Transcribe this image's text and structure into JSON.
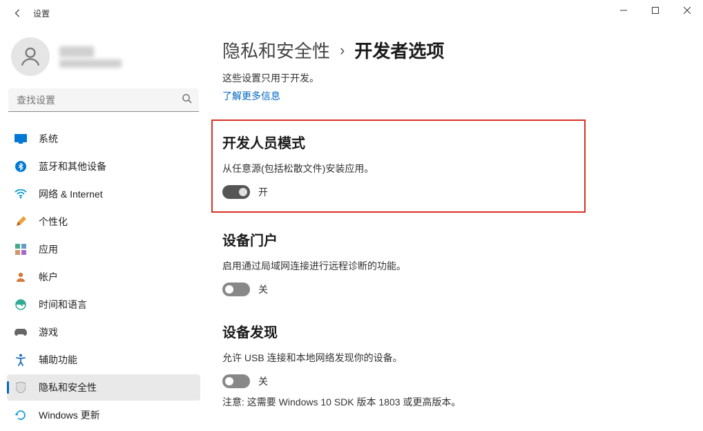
{
  "window": {
    "title": "设置"
  },
  "search": {
    "placeholder": "查找设置"
  },
  "sidebar": {
    "items": [
      {
        "label": "系统",
        "icon": "system"
      },
      {
        "label": "蓝牙和其他设备",
        "icon": "bluetooth"
      },
      {
        "label": "网络 & Internet",
        "icon": "network"
      },
      {
        "label": "个性化",
        "icon": "personalize"
      },
      {
        "label": "应用",
        "icon": "apps"
      },
      {
        "label": "帐户",
        "icon": "account"
      },
      {
        "label": "时间和语言",
        "icon": "time"
      },
      {
        "label": "游戏",
        "icon": "gaming"
      },
      {
        "label": "辅助功能",
        "icon": "accessibility"
      },
      {
        "label": "隐私和安全性",
        "icon": "privacy",
        "selected": true
      },
      {
        "label": "Windows 更新",
        "icon": "update"
      }
    ]
  },
  "breadcrumb": {
    "parent": "隐私和安全性",
    "current": "开发者选项"
  },
  "intro": {
    "line1": "这些设置只用于开发。",
    "learn_more": "了解更多信息"
  },
  "sections": {
    "dev_mode": {
      "title": "开发人员模式",
      "desc": "从任意源(包括松散文件)安装应用。",
      "toggle_state": "开",
      "on": true
    },
    "device_portal": {
      "title": "设备门户",
      "desc": "启用通过局域网连接进行远程诊断的功能。",
      "toggle_state": "关",
      "on": false
    },
    "device_discovery": {
      "title": "设备发现",
      "desc": "允许 USB 连接和本地网络发现你的设备。",
      "toggle_state": "关",
      "on": false,
      "note": "注意: 这需要 Windows 10 SDK 版本 1803 或更高版本。"
    }
  }
}
